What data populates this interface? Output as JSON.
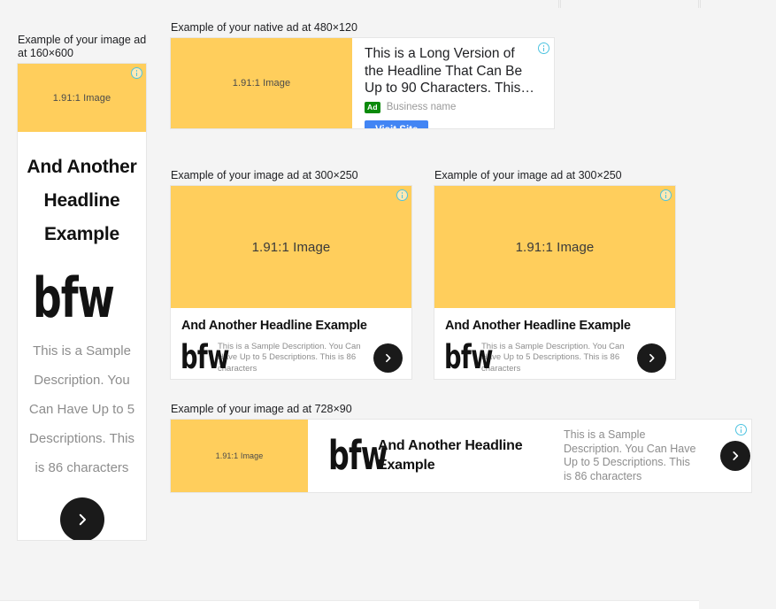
{
  "page": {
    "background_color": "#f4f4f4"
  },
  "colors": {
    "image_placeholder": "#ffce5c",
    "ad_badge_green": "#0a8a0a",
    "visit_button_blue": "#4285f4",
    "adchoices_blue": "#4dc3e0",
    "cta_circle": "#1a1a1a",
    "description_gray": "#8d8d8d"
  },
  "shared": {
    "image_placeholder_text": "1.91:1 Image",
    "headline": "And Another Headline Example",
    "description": "This is a Sample Description. You Can Have Up to 5 Descriptions. This is 86 characters",
    "logo_text": "bfw",
    "adchoices_icon": "info-icon"
  },
  "previews": [
    {
      "id": "ad160",
      "label": "Example of your image ad at 160×600",
      "size": "160×600",
      "format": "image",
      "image_placeholder_text": "1.91:1 Image",
      "headline": "And Another Headline Example",
      "logo_text": "bfw",
      "description": "This is a Sample Description. You Can Have Up to 5 Descriptions. This is 86 characters",
      "cta_icon": "chevron-right-icon"
    },
    {
      "id": "adNative",
      "label": "Example of your native ad at 480×120",
      "size": "480×120",
      "format": "native",
      "image_placeholder_text": "1.91:1 Image",
      "headline": "This is a Long Version of the Headline That Can Be Up to 90 Characters. This…",
      "ad_badge": "Ad",
      "business_name": "Business name",
      "cta_label": "Visit Site"
    },
    {
      "id": "ad300a",
      "label": "Example of your image ad at 300×250",
      "size": "300×250",
      "format": "image",
      "image_placeholder_text": "1.91:1 Image",
      "headline": "And Another Headline Example",
      "logo_text": "bfw",
      "description": "This is a Sample Description. You Can Have Up to 5 Descriptions. This is 86 characters",
      "cta_icon": "chevron-right-icon"
    },
    {
      "id": "ad300b",
      "label": "Example of your image ad at 300×250",
      "size": "300×250",
      "format": "image",
      "image_placeholder_text": "1.91:1 Image",
      "headline": "And Another Headline Example",
      "logo_text": "bfw",
      "description": "This is a Sample Description. You Can Have Up to 5 Descriptions. This is 86 characters",
      "cta_icon": "chevron-right-icon"
    },
    {
      "id": "ad728",
      "label": "Example of your image ad at 728×90",
      "size": "728×90",
      "format": "image",
      "image_placeholder_text": "1.91:1 Image",
      "headline": "And Another Headline Example",
      "logo_text": "bfw",
      "description": "This is a Sample Description. You Can Have Up to 5 Descriptions. This is 86 characters",
      "cta_icon": "chevron-right-icon"
    }
  ]
}
